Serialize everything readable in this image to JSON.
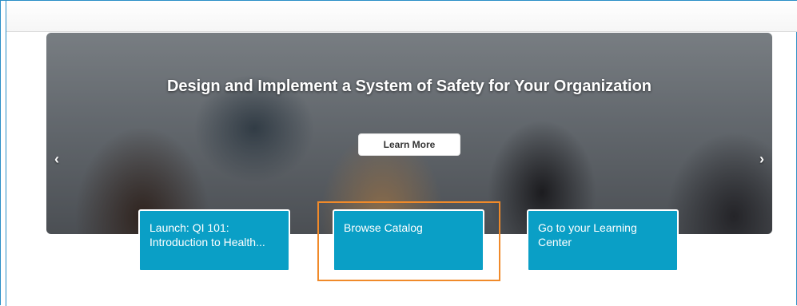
{
  "hero": {
    "title": "Design and Implement a System of Safety for Your Organization",
    "cta_label": "Learn More",
    "prev_icon": "chevron-left-icon",
    "next_icon": "chevron-right-icon",
    "prev_glyph": "‹",
    "next_glyph": "›"
  },
  "tiles": [
    {
      "label": "Launch: QI 101: Introduction to Health..."
    },
    {
      "label": "Browse Catalog"
    },
    {
      "label": "Go to your Learning Center"
    }
  ],
  "colors": {
    "tile_bg": "#0a9fc6",
    "highlight": "#f08a2a",
    "frame": "#2a8fc7"
  }
}
